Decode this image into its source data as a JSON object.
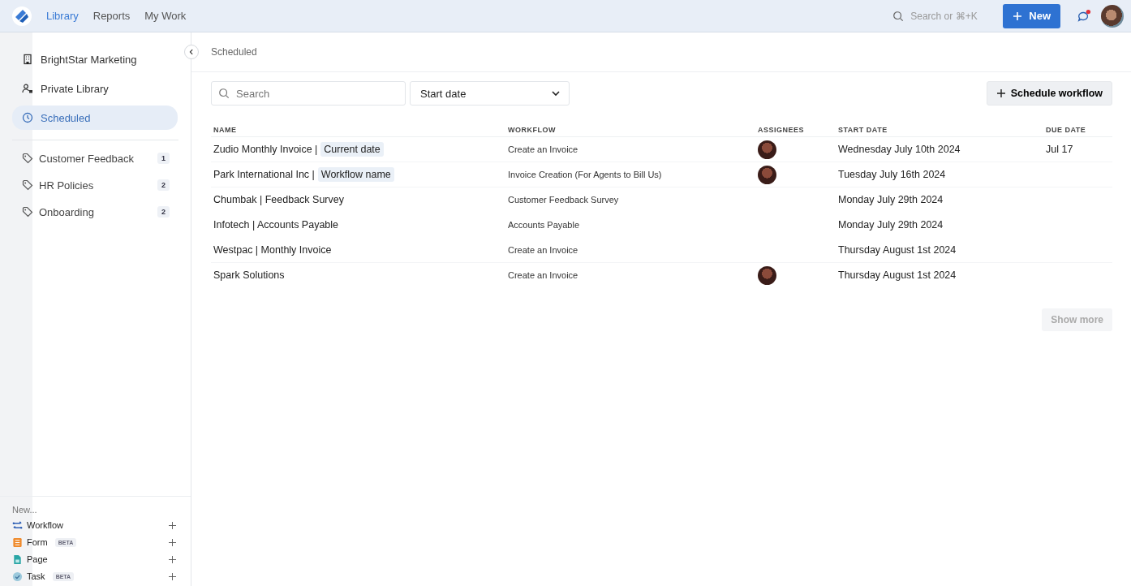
{
  "nav": {
    "tabs": [
      {
        "label": "Library",
        "selected": true
      },
      {
        "label": "Reports",
        "selected": false
      },
      {
        "label": "My Work",
        "selected": false
      }
    ],
    "search": {
      "placeholder": "Search or ⌘+K"
    },
    "new_button": "New",
    "notifications": {
      "unread": true
    }
  },
  "sidebar": {
    "items": [
      {
        "label": "BrightStar Marketing",
        "kind": "building",
        "selected": false
      },
      {
        "label": "Private Library",
        "kind": "private",
        "selected": false
      },
      {
        "label": "Scheduled",
        "kind": "clock",
        "selected": true
      }
    ],
    "tags": [
      {
        "label": "Customer Feedback",
        "count": "1"
      },
      {
        "label": "HR Policies",
        "count": "2"
      },
      {
        "label": "Onboarding",
        "count": "2"
      }
    ],
    "new_section": {
      "title": "New...",
      "items": [
        {
          "label": "Workflow",
          "kind": "workflow",
          "beta": false
        },
        {
          "label": "Form",
          "kind": "form",
          "beta": true,
          "badge": "BETA"
        },
        {
          "label": "Page",
          "kind": "page",
          "beta": false
        },
        {
          "label": "Task",
          "kind": "task",
          "beta": true,
          "badge": "BETA"
        }
      ]
    }
  },
  "breadcrumb": "Scheduled",
  "filters": {
    "search": {
      "placeholder": "Search"
    },
    "sort": {
      "value": "Start date"
    },
    "schedule_button": "Schedule workflow"
  },
  "table": {
    "columns": [
      "NAME",
      "WORKFLOW",
      "ASSIGNEES",
      "START DATE",
      "DUE DATE"
    ],
    "rows": [
      {
        "name": "Zudio Monthly Invoice |",
        "tag": "Current date",
        "workflow": "Create an Invoice",
        "assigned": true,
        "start": "Wednesday July 10th 2024",
        "due": "Jul 17"
      },
      {
        "name": "Park International Inc |",
        "tag": "Workflow name",
        "workflow": "Invoice Creation (For Agents to Bill Us)",
        "assigned": true,
        "start": "Tuesday July 16th 2024"
      },
      {
        "name": "Chumbak | Feedback Survey",
        "workflow": "Customer Feedback Survey",
        "assigned": false,
        "start": "Monday July 29th 2024"
      },
      {
        "name": "Infotech | Accounts Payable",
        "workflow": "Accounts Payable",
        "assigned": false,
        "start": "Monday July 29th 2024"
      },
      {
        "name": "Westpac | Monthly Invoice",
        "workflow": "Create an Invoice",
        "assigned": false,
        "start": "Thursday August 1st 2024"
      },
      {
        "name": "Spark Solutions",
        "workflow": "Create an Invoice",
        "assigned": true,
        "start": "Thursday August 1st 2024"
      }
    ]
  },
  "show_more": "Show more"
}
